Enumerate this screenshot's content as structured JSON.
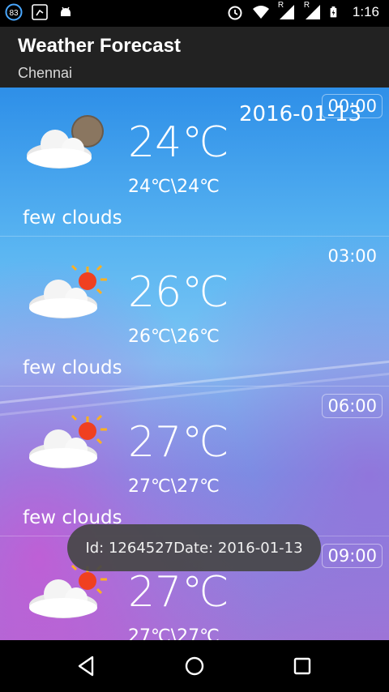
{
  "status_bar": {
    "notification_count": "83",
    "time": "1:16",
    "roaming_marks": [
      "R",
      "R"
    ]
  },
  "app_bar": {
    "title": "Weather Forecast",
    "subtitle": "Chennai"
  },
  "date_label": "2016-01-13",
  "forecast": [
    {
      "time": "00:00",
      "temp": "24℃",
      "minmax": "24℃\\24℃",
      "description": "few clouds",
      "icon": "cloud-moon-icon"
    },
    {
      "time": "03:00",
      "temp": "26℃",
      "minmax": "26℃\\26℃",
      "description": "few clouds",
      "icon": "cloud-sun-icon"
    },
    {
      "time": "06:00",
      "temp": "27℃",
      "minmax": "27℃\\27℃",
      "description": "few clouds",
      "icon": "cloud-sun-icon"
    },
    {
      "time": "09:00",
      "temp": "27℃",
      "minmax": "27℃\\27℃",
      "description": "",
      "icon": "cloud-sun-icon"
    }
  ],
  "toast": {
    "text": "Id: 1264527Date: 2016-01-13"
  },
  "nav": {
    "back": "back-icon",
    "home": "home-icon",
    "recents": "recents-icon"
  }
}
